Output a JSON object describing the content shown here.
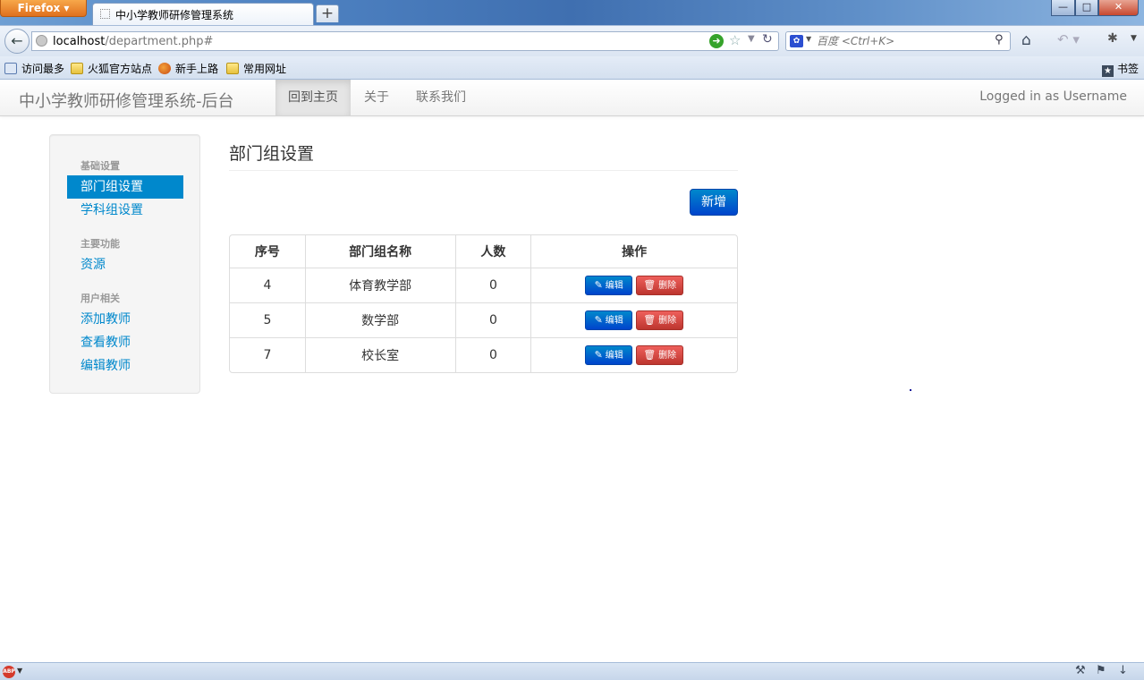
{
  "browser": {
    "menu_label": "Firefox ▾",
    "tab_title": "中小学教师研修管理系统",
    "new_tab": "+",
    "url_host": "localhost",
    "url_path": "/department.php#",
    "search_placeholder": "百度 <Ctrl+K>",
    "bookmarks": [
      "访问最多",
      "火狐官方站点",
      "新手上路",
      "常用网址"
    ],
    "bookmarks_menu": "书签"
  },
  "site": {
    "brand": "中小学教师研修管理系统-后台",
    "nav": [
      "回到主页",
      "关于",
      "联系我们"
    ],
    "logged_in": "Logged in as Username"
  },
  "sidebar": {
    "sections": [
      {
        "header": "基础设置",
        "items": [
          "部门组设置",
          "学科组设置"
        ]
      },
      {
        "header": "主要功能",
        "items": [
          "资源"
        ]
      },
      {
        "header": "用户相关",
        "items": [
          "添加教师",
          "查看教师",
          "编辑教师"
        ]
      }
    ]
  },
  "main": {
    "title": "部门组设置",
    "add_button": "新增",
    "table": {
      "headers": [
        "序号",
        "部门组名称",
        "人数",
        "操作"
      ],
      "rows": [
        {
          "id": "4",
          "name": "体育教学部",
          "count": "0"
        },
        {
          "id": "5",
          "name": "数学部",
          "count": "0"
        },
        {
          "id": "7",
          "name": "校长室",
          "count": "0"
        }
      ],
      "edit_label": "编辑",
      "delete_label": "删除"
    }
  },
  "colors": {
    "primary": "#0088cc",
    "danger": "#da4f49",
    "browser_frame": "#4e82c2"
  }
}
